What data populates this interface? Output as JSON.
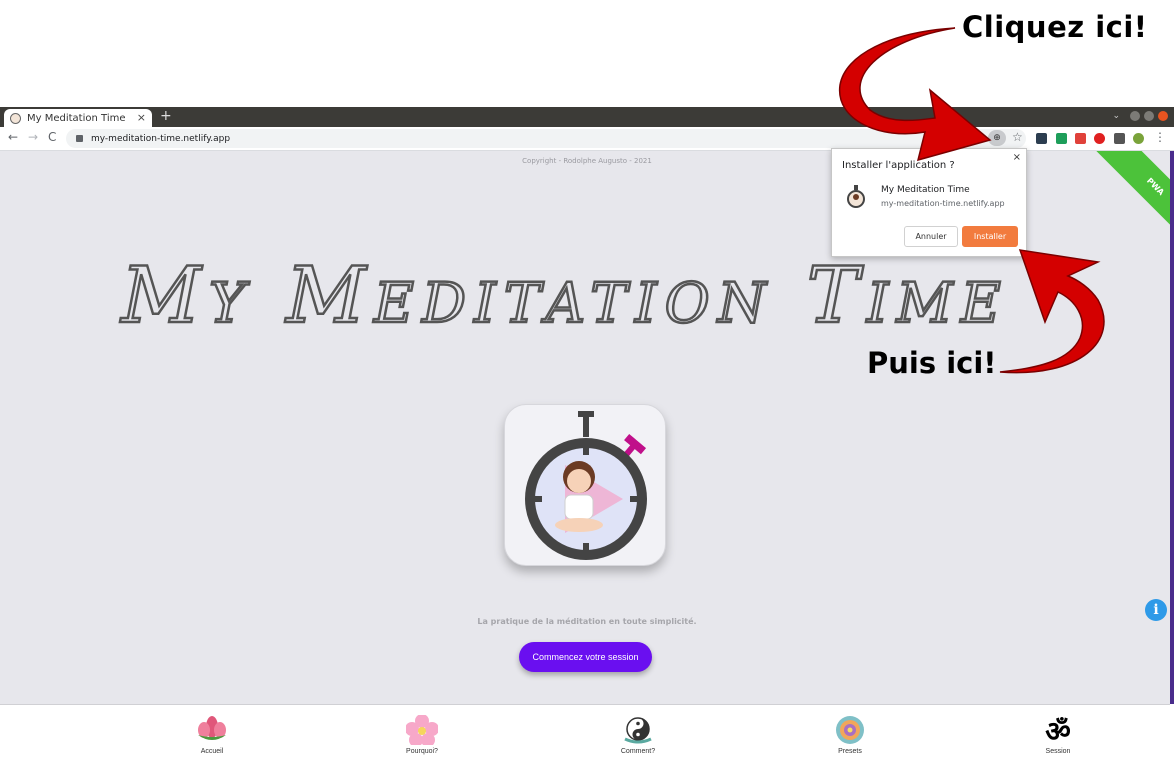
{
  "annotations": {
    "top": "Cliquez ici!",
    "bottom": "Puis ici!"
  },
  "browser": {
    "tab_title": "My Meditation Time",
    "tab_close": "×",
    "new_tab": "+",
    "url": "my-meditation-time.netlify.app",
    "back": "←",
    "forward": "→",
    "reload": "C",
    "star": "☆",
    "menu": "⋮",
    "chevron": "⌄",
    "install_icon_glyph": "⊕"
  },
  "page": {
    "copyright": "Copyright - Rodolphe Augusto - 2021",
    "title": "My Meditation Time",
    "tagline": "La pratique de la méditation en toute simplicité.",
    "cta_label": "Commencez votre session",
    "info_glyph": "i",
    "ribbon": "PWA"
  },
  "install_popup": {
    "title": "Installer l'application ?",
    "close": "×",
    "app_name": "My Meditation Time",
    "app_url": "my-meditation-time.netlify.app",
    "cancel_label": "Annuler",
    "install_label": "Installer"
  },
  "bottom_nav": [
    {
      "label": "Accueil",
      "icon": "lotus-icon"
    },
    {
      "label": "Pourquoi?",
      "icon": "flower-icon"
    },
    {
      "label": "Comment?",
      "icon": "yin-yang-icon"
    },
    {
      "label": "Presets",
      "icon": "mandala-icon"
    },
    {
      "label": "Session",
      "icon": "om-icon"
    }
  ],
  "colors": {
    "page_bg": "#e7e7ec",
    "cta": "#6a0ff0",
    "install_button": "#f27b3e",
    "ribbon": "#4cc23a",
    "info": "#2e9ae8",
    "arrow": "#d40000"
  }
}
